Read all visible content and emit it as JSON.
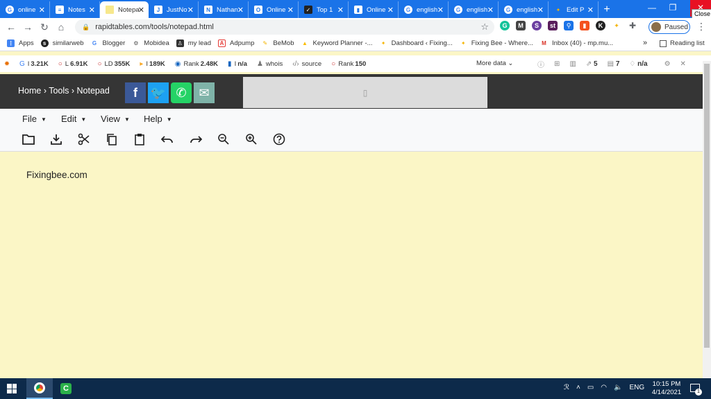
{
  "browser": {
    "tabs": [
      {
        "label": "online",
        "icon": "google-icon",
        "active": false
      },
      {
        "label": "Notes",
        "icon": "doc-icon",
        "active": false
      },
      {
        "label": "Notepad",
        "icon": "notepad-icon",
        "active": true
      },
      {
        "label": "JustNotes",
        "icon": "doc-icon",
        "active": false
      },
      {
        "label": "Nathan",
        "icon": "doc-icon",
        "active": false
      },
      {
        "label": "Online",
        "icon": "doc-icon",
        "active": false
      },
      {
        "label": "Top 1",
        "icon": "dark-icon",
        "active": false
      },
      {
        "label": "Online",
        "icon": "doc-icon",
        "active": false
      },
      {
        "label": "english",
        "icon": "google-icon",
        "active": false
      },
      {
        "label": "english",
        "icon": "google-icon",
        "active": false
      },
      {
        "label": "english",
        "icon": "google-icon",
        "active": false
      },
      {
        "label": "Edit P",
        "icon": "bee-icon",
        "active": false
      }
    ],
    "close_tooltip": "Close",
    "url": "rapidtables.com/tools/notepad.html",
    "profile_status": "Paused"
  },
  "bookmarks": {
    "items": [
      {
        "label": "Apps",
        "color": "#4285f4"
      },
      {
        "label": "similarweb",
        "color": "#222222"
      },
      {
        "label": "Blogger",
        "color": "#4285f4"
      },
      {
        "label": "Mobidea",
        "color": "#555555"
      },
      {
        "label": "my lead",
        "color": "#333333"
      },
      {
        "label": "Adpump",
        "color": "#e53935"
      },
      {
        "label": "BeMob",
        "color": "#f4b400"
      },
      {
        "label": "Keyword Planner -...",
        "color": "#fbbc04"
      },
      {
        "label": "Dashboard ‹ Fixing...",
        "color": "#f5b400"
      },
      {
        "label": "Fixing Bee - Where...",
        "color": "#f5b400"
      },
      {
        "label": "Inbox (40) - mp.mu...",
        "color": "#d93025"
      }
    ],
    "more": "»",
    "reading_list": "Reading list"
  },
  "seobar": {
    "items": [
      {
        "prefix": "I",
        "value": "3.21K",
        "icon": "G"
      },
      {
        "prefix": "L",
        "value": "6.91K",
        "icon": "○"
      },
      {
        "prefix": "LD",
        "value": "355K",
        "icon": "○"
      },
      {
        "prefix": "I",
        "value": "189K",
        "icon": "▸"
      },
      {
        "prefix": "Rank",
        "value": "2.48K",
        "icon": "◉"
      },
      {
        "prefix": "I",
        "value": "n/a",
        "icon": "▮"
      },
      {
        "prefix": "",
        "value": "whois",
        "icon": "♟"
      },
      {
        "prefix": "",
        "value": "source",
        "icon": "‹/›"
      },
      {
        "prefix": "Rank",
        "value": "150",
        "icon": "○"
      }
    ],
    "more_data": "More data",
    "right_values": [
      "5",
      "7",
      "n/a"
    ]
  },
  "page": {
    "breadcrumb": "Home › Tools › Notepad",
    "menus": [
      "File",
      "Edit",
      "View",
      "Help"
    ],
    "editor_text": "Fixingbee.com"
  },
  "taskbar": {
    "lang": "ENG",
    "time": "10:15 PM",
    "date": "4/14/2021",
    "notif_count": "1"
  }
}
